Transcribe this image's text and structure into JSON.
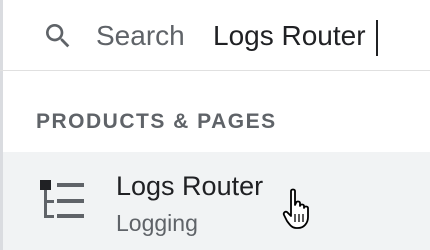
{
  "search": {
    "label": "Search",
    "query": "Logs Router"
  },
  "section": {
    "heading": "PRODUCTS & PAGES"
  },
  "results": [
    {
      "title": "Logs Router",
      "subtitle": "Logging",
      "icon": "logs-router-icon"
    }
  ],
  "icons": {
    "search": "search-icon",
    "cursor": "hand-pointer-cursor-icon"
  },
  "colors": {
    "text_primary": "#202124",
    "text_secondary": "#5f6368",
    "row_hover": "#f1f3f4",
    "divider": "#e0e0e0"
  }
}
